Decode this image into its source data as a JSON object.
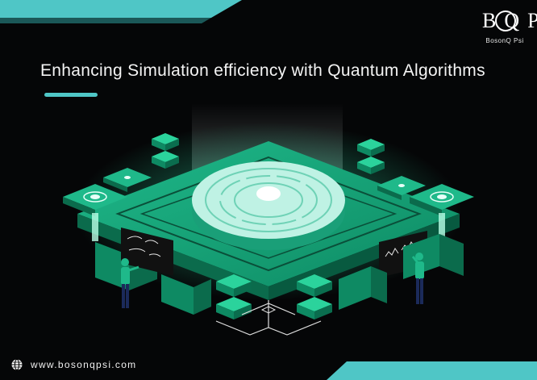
{
  "title": "Enhancing Simulation efficiency with Quantum Algorithms",
  "logo": {
    "mark": "BQP",
    "name": "BosonQ Psi"
  },
  "footer": {
    "website": "www.bosonqpsi.com",
    "icon": "globe-icon"
  },
  "colors": {
    "accent": "#4fc6c6",
    "green": "#1fb98a",
    "dark_green": "#0b6b4c",
    "background": "#050607"
  }
}
